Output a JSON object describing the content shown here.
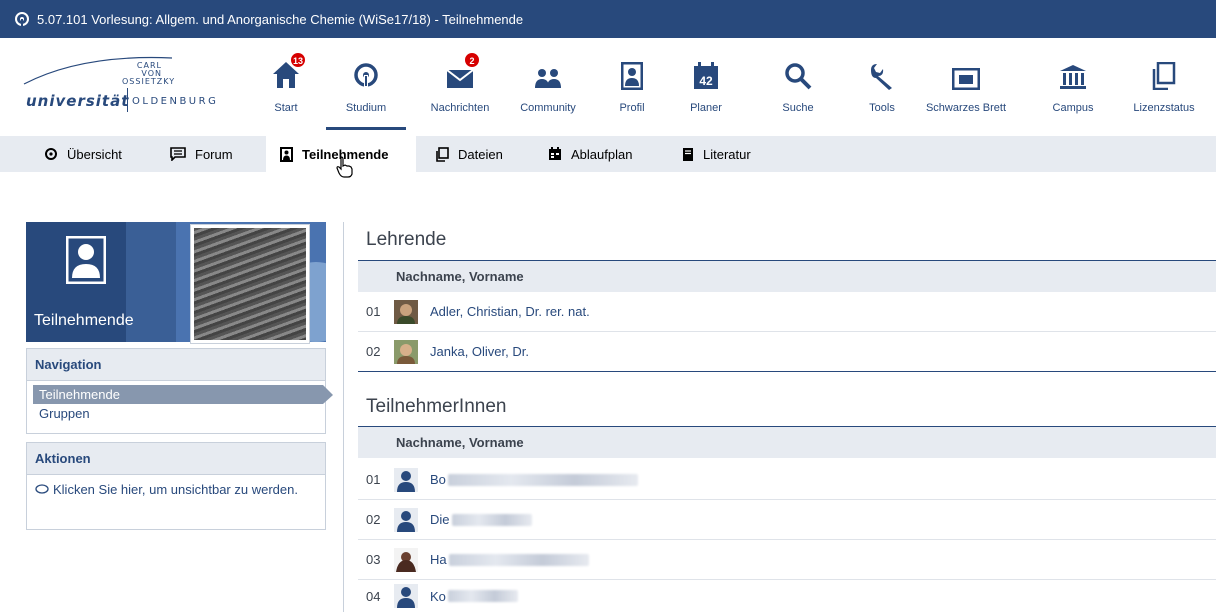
{
  "window": {
    "title": "5.07.101 Vorlesung: Allgem. und Anorganische Chemie (WiSe17/18) - Teilnehmende"
  },
  "logo": {
    "line1": "CARL",
    "line2": "VON",
    "line3": "OSSIETZKY",
    "uni": "universität",
    "city": "OLDENBURG"
  },
  "nav": [
    {
      "label": "Start",
      "icon": "home-icon",
      "badge": "13"
    },
    {
      "label": "Studium",
      "icon": "studium-icon",
      "badge": ""
    },
    {
      "label": "Nachrichten",
      "icon": "mail-icon",
      "badge": "2"
    },
    {
      "label": "Community",
      "icon": "community-icon",
      "badge": ""
    },
    {
      "label": "Profil",
      "icon": "profile-icon",
      "badge": ""
    },
    {
      "label": "Planer",
      "icon": "calendar-icon",
      "badge": ""
    },
    {
      "label": "Suche",
      "icon": "search-icon",
      "badge": ""
    },
    {
      "label": "Tools",
      "icon": "wrench-icon",
      "badge": ""
    },
    {
      "label": "Schwarzes Brett",
      "icon": "board-icon",
      "badge": ""
    },
    {
      "label": "Campus",
      "icon": "campus-icon",
      "badge": ""
    },
    {
      "label": "Lizenzstatus",
      "icon": "license-icon",
      "badge": ""
    }
  ],
  "calendar_day": "42",
  "tabs": [
    "Übersicht",
    "Forum",
    "Teilnehmende",
    "Dateien",
    "Ablaufplan",
    "Literatur"
  ],
  "sidebar": {
    "header": "Teilnehmende",
    "navigation": {
      "title": "Navigation",
      "items": [
        "Teilnehmende",
        "Gruppen"
      ]
    },
    "actions": {
      "title": "Aktionen",
      "items": [
        "Klicken Sie hier, um unsichtbar zu werden."
      ]
    }
  },
  "lehrende": {
    "title": "Lehrende",
    "column": "Nachname, Vorname",
    "rows": [
      {
        "num": "01",
        "name": "Adler, Christian, Dr. rer. nat."
      },
      {
        "num": "02",
        "name": "Janka, Oliver, Dr."
      }
    ]
  },
  "teilnehmer": {
    "title": "TeilnehmerInnen",
    "column": "Nachname, Vorname",
    "rows": [
      {
        "num": "01",
        "name": "Bo"
      },
      {
        "num": "02",
        "name": "Die"
      },
      {
        "num": "03",
        "name": "Ha"
      },
      {
        "num": "04",
        "name": "Ko"
      }
    ]
  },
  "colors": {
    "primary": "#28497c",
    "tabbar": "#e7ebf1",
    "badge": "#d60000",
    "active_nav": "#8797ae"
  }
}
